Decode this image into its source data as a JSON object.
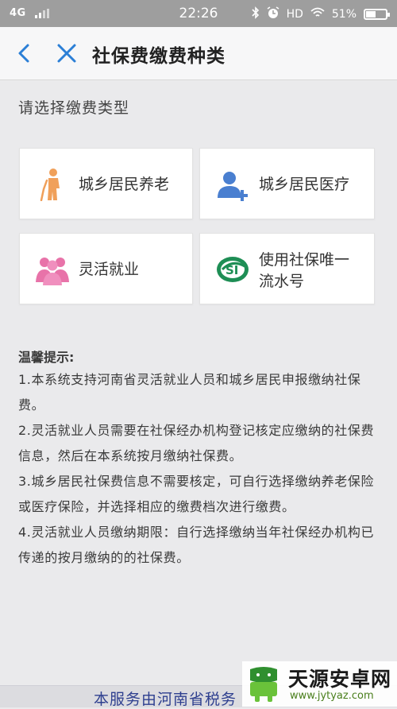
{
  "status_bar": {
    "network": "4G",
    "time": "22:26",
    "hd": "HD",
    "battery": "51%",
    "battery_level": 0.51
  },
  "nav": {
    "title": "社保费缴费种类",
    "back_icon": "chevron-left-icon",
    "close_icon": "close-icon"
  },
  "prompt": "请选择缴费类型",
  "options": [
    {
      "label": "城乡居民养老",
      "icon": "elderly-person-icon"
    },
    {
      "label": "城乡居民医疗",
      "icon": "user-plus-icon"
    },
    {
      "label": "灵活就业",
      "icon": "people-group-icon"
    },
    {
      "label_line1": "使用社保唯一",
      "label_line2": "流水号",
      "icon": "social-insurance-logo-icon"
    }
  ],
  "tips": {
    "heading": "温馨提示:",
    "items": [
      "1.本系统支持河南省灵活就业人员和城乡居民申报缴纳社保费。",
      "2.灵活就业人员需要在社保经办机构登记核定应缴纳的社保费信息，然后在本系统按月缴纳社保费。",
      "3.城乡居民社保费信息不需要核定，可自行选择缴纳养老保险或医疗保险，并选择相应的缴费档次进行缴费。",
      "4.灵活就业人员缴纳期限：自行选择缴纳当年社保经办机构已传递的按月缴纳的的社保费。"
    ]
  },
  "footer": {
    "text": "本服务由河南省税务"
  },
  "watermark": {
    "name": "天源安卓网",
    "url": "www.jytyaz.com"
  },
  "colors": {
    "accent_blue": "#2b7fd6",
    "elderly_orange": "#f0a05a",
    "user_blue": "#4a7fd0",
    "group_pink": "#e873a9",
    "si_green": "#1e8e55",
    "footer_text": "#2e3f8f"
  }
}
